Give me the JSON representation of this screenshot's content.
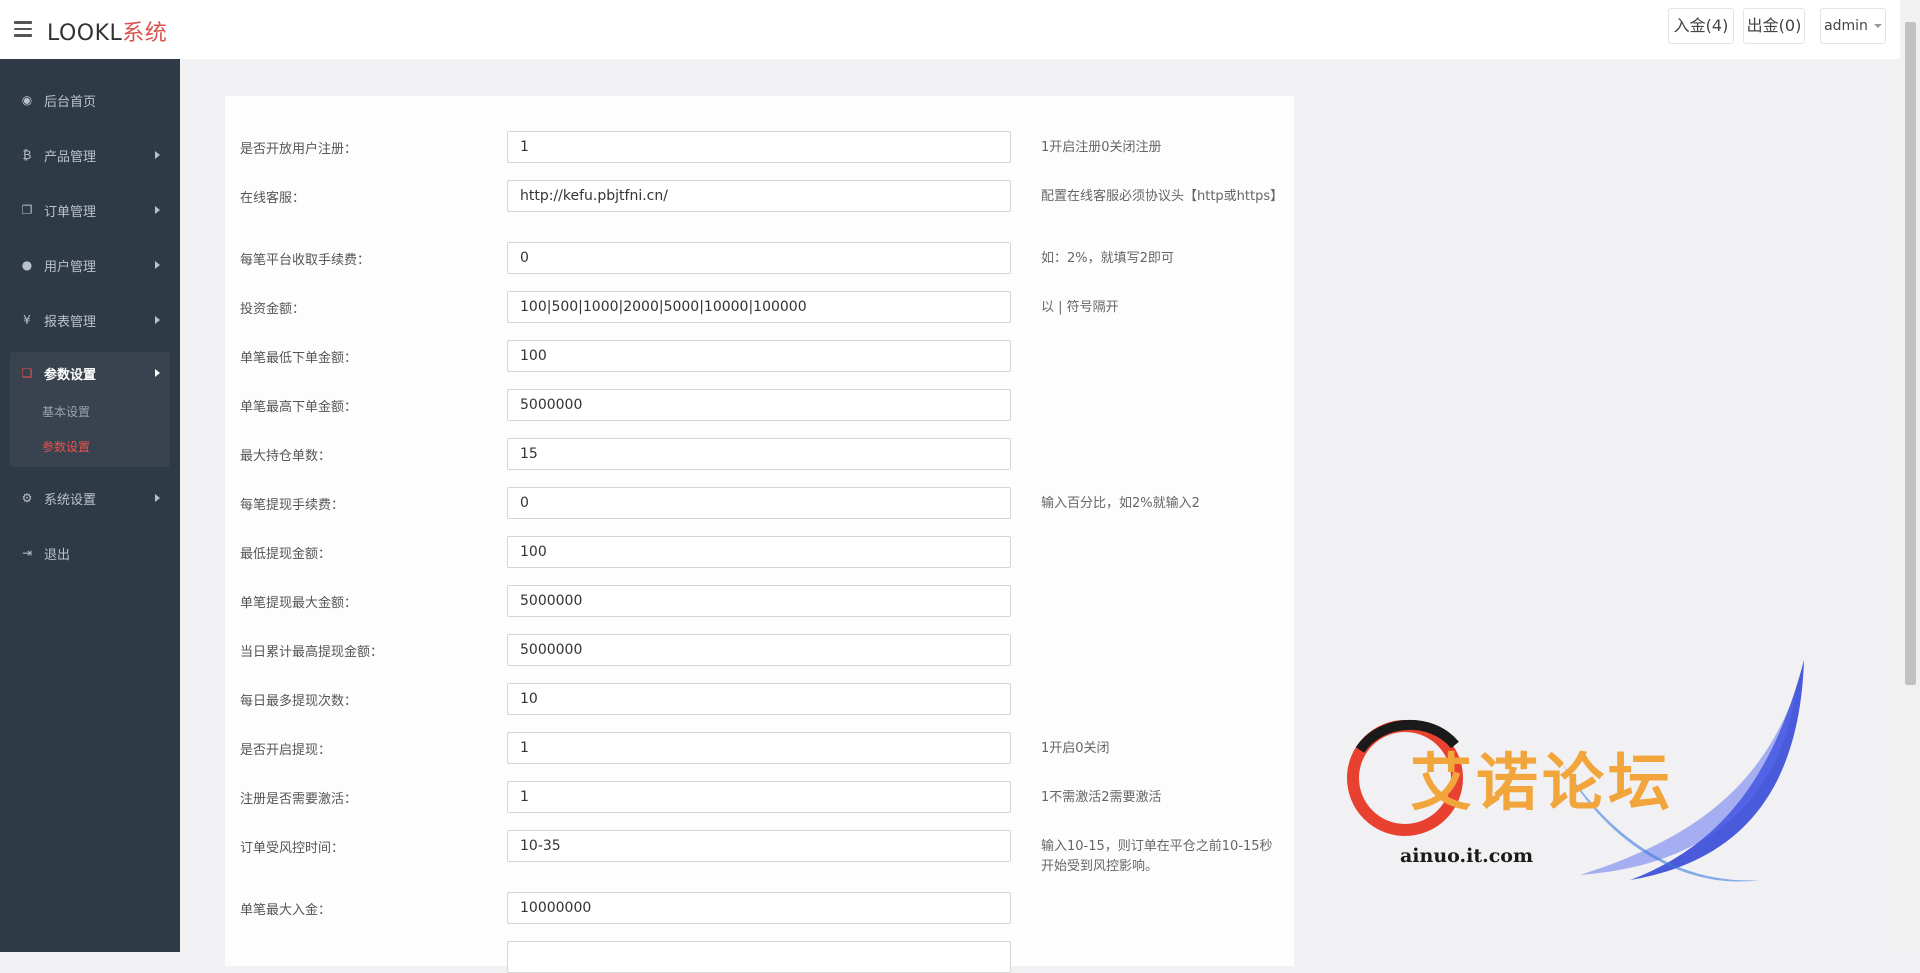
{
  "header": {
    "brand_main": "LOOKL",
    "brand_accent": "系统",
    "deposit_label": "入金(4)",
    "withdraw_label": "出金(0)",
    "user_label": "admin"
  },
  "sidebar": {
    "items": [
      {
        "label": "后台首页",
        "icon": "dashboard-icon"
      },
      {
        "label": "产品管理",
        "icon": "bitcoin-icon"
      },
      {
        "label": "订单管理",
        "icon": "copy-icon"
      },
      {
        "label": "用户管理",
        "icon": "user-icon"
      },
      {
        "label": "报表管理",
        "icon": "yen-icon"
      },
      {
        "label": "参数设置",
        "icon": "files-icon"
      },
      {
        "label": "系统设置",
        "icon": "gears-icon"
      },
      {
        "label": "退出",
        "icon": "sign-out-icon"
      }
    ],
    "sub_items": [
      {
        "label": "基本设置",
        "active": false
      },
      {
        "label": "参数设置",
        "active": true
      }
    ],
    "active_color": "#e9534f"
  },
  "form": {
    "rows": [
      {
        "label": "是否开放用户注册：",
        "value": "1",
        "hint": "1开启注册0关闭注册"
      },
      {
        "label": "在线客服：",
        "value": "http://kefu.pbjtfni.cn/",
        "hint": "配置在线客服必须协议头【http或https】"
      },
      {
        "label": "每笔平台收取手续费：",
        "value": "0",
        "hint": "如：2%，就填写2即可"
      },
      {
        "label": "投资金额：",
        "value": "100|500|1000|2000|5000|10000|100000",
        "hint": "以 | 符号隔开"
      },
      {
        "label": "单笔最低下单金额：",
        "value": "100",
        "hint": ""
      },
      {
        "label": "单笔最高下单金额：",
        "value": "5000000",
        "hint": ""
      },
      {
        "label": "最大持仓单数：",
        "value": "15",
        "hint": ""
      },
      {
        "label": "每笔提现手续费：",
        "value": "0",
        "hint": "输入百分比，如2%就输入2"
      },
      {
        "label": "最低提现金额：",
        "value": "100",
        "hint": ""
      },
      {
        "label": "单笔提现最大金额：",
        "value": "5000000",
        "hint": ""
      },
      {
        "label": "当日累计最高提现金额：",
        "value": "5000000",
        "hint": ""
      },
      {
        "label": "每日最多提现次数：",
        "value": "10",
        "hint": ""
      },
      {
        "label": "是否开启提现：",
        "value": "1",
        "hint": "1开启0关闭"
      },
      {
        "label": "注册是否需要激活：",
        "value": "1",
        "hint": "1不需激活2需要激活"
      },
      {
        "label": "订单受风控时间：",
        "value": "10-35",
        "hint": "输入10-15，则订单在平仓之前10-15秒开始受到风控影响。"
      },
      {
        "label": "单笔最大入金：",
        "value": "10000000",
        "hint": ""
      },
      {
        "label": "",
        "value": "",
        "hint": ""
      }
    ]
  },
  "watermark": {
    "text": "艾诺论坛",
    "url": "ainuo.it.com"
  }
}
